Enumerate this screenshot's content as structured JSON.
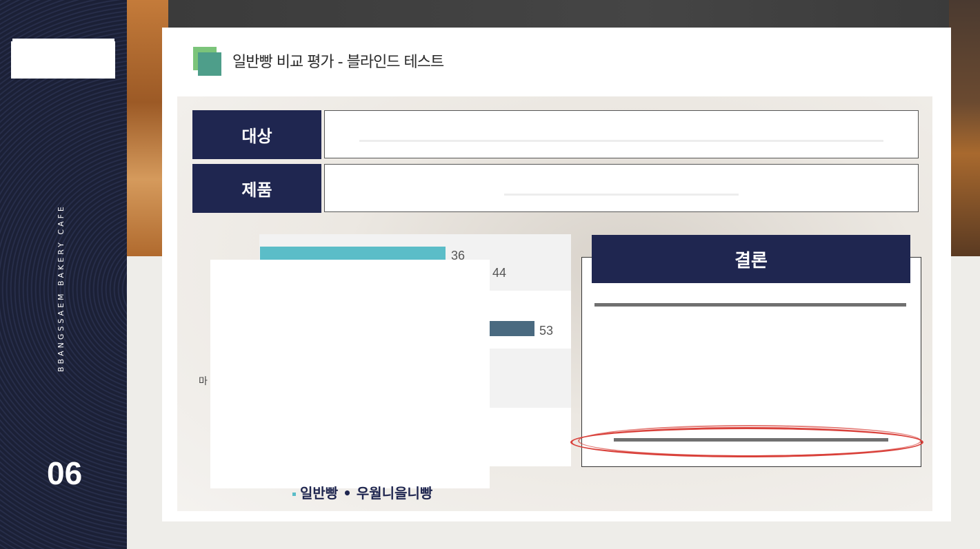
{
  "sidebar": {
    "brand_vertical": "BBANGSSAEM BAKERY CAFE",
    "page_number": "06"
  },
  "slide": {
    "title": "일반빵 비교 평가 - 블라인드 테스트"
  },
  "rows": [
    {
      "label": "대상"
    },
    {
      "label": "제품"
    }
  ],
  "chart": {
    "visible_values": [
      "36",
      "44",
      "53"
    ],
    "category_peek": "마",
    "legend_peek": "일반빵 • 우월니을니빵",
    "colors": {
      "bar1": "#5bbdc8",
      "bar2": "#4a6a80"
    }
  },
  "conclusion": {
    "header": "결론"
  },
  "colors": {
    "navy": "#1f2650",
    "highlight_red": "#d9413b",
    "accent_green": "#7bc47a",
    "accent_teal": "#4e9e8a"
  }
}
